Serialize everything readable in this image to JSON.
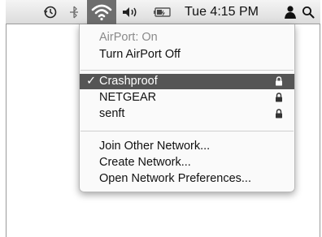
{
  "menubar": {
    "clock_label": "Tue 4:15 PM",
    "icons": [
      "time-machine-icon",
      "bluetooth-icon",
      "wifi-icon",
      "volume-icon",
      "battery-icon",
      "user-icon",
      "spotlight-search-icon"
    ]
  },
  "airport_menu": {
    "status": "AirPort: On",
    "toggle": "Turn AirPort Off",
    "networks": [
      {
        "check": "✓",
        "name": "Crashproof",
        "locked": true,
        "selected": true
      },
      {
        "name": "NETGEAR",
        "locked": true,
        "selected": false
      },
      {
        "name": "senft",
        "locked": true,
        "selected": false
      }
    ],
    "actions": {
      "join_other": "Join Other Network...",
      "create": "Create Network...",
      "open_prefs": "Open Network Preferences..."
    }
  },
  "colors": {
    "selection": "#555555",
    "menubar_highlight": "#6e6e6e",
    "disabled_text": "#8a8a8a"
  }
}
